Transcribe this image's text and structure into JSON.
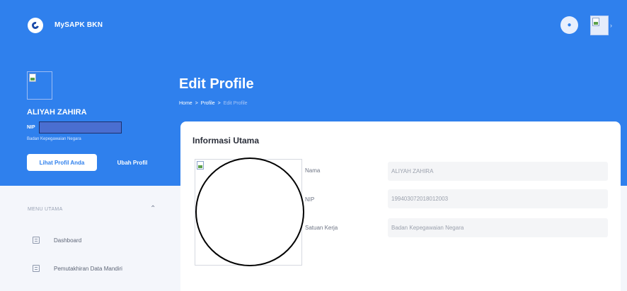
{
  "header": {
    "app_title": "MySAPK BKN",
    "icons": [
      "logo-icon",
      "bell-icon",
      "avatar-image-icon",
      "chevron-right-icon"
    ]
  },
  "profile": {
    "name": "ALIYAH ZAHIRA",
    "nip_label": "NIP",
    "agency": "Badan Kepegawaian Negara",
    "view_button": "Lihat Profil Anda",
    "edit_button": "Ubah Profil"
  },
  "menu": {
    "section_title": "MENU UTAMA",
    "items": [
      {
        "label": "Dashboard",
        "icon": "document-icon"
      },
      {
        "label": "Pemutakhiran Data Mandiri",
        "icon": "document-icon"
      }
    ]
  },
  "page": {
    "title": "Edit Profile",
    "breadcrumb": {
      "home": "Home",
      "sep1": ">",
      "profile": "Profile",
      "sep2": ">",
      "current": "Edit Profile"
    }
  },
  "card": {
    "title": "Informasi Utama",
    "fields": [
      {
        "label": "Nama",
        "value": "ALIYAH ZAHIRA"
      },
      {
        "label": "NIP",
        "value": "199403072018012003"
      },
      {
        "label": "Satuan Kerja",
        "value": "Badan Kepegawaian Negara"
      }
    ]
  },
  "colors": {
    "brand_blue": "#2f80ed",
    "background": "#f4f6fb"
  }
}
